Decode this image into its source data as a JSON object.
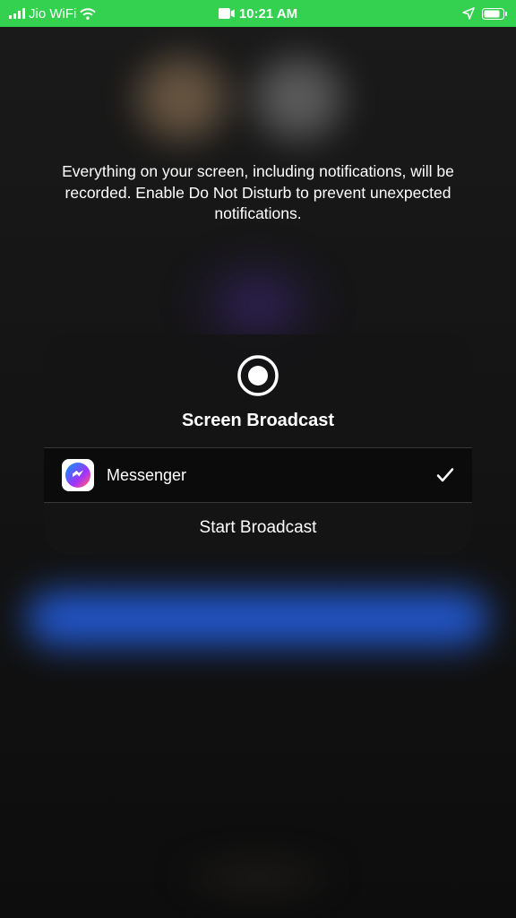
{
  "status_bar": {
    "carrier": "Jio WiFi",
    "time": "10:21 AM"
  },
  "disclosure_text": "Everything on your screen, including notifications, will be recorded. Enable Do Not Disturb to prevent unexpected notifications.",
  "broadcast_card": {
    "title": "Screen Broadcast",
    "selected_app": "Messenger",
    "start_label": "Start Broadcast"
  }
}
